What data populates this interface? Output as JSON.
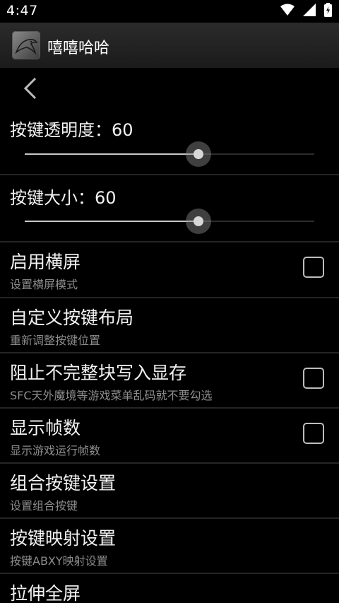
{
  "status_bar": {
    "time": "4:47",
    "icons": [
      "wifi-icon",
      "signal-icon",
      "battery-icon"
    ]
  },
  "action_bar": {
    "title": "嘻嘻哈哈",
    "icon": "app-logo-icon"
  },
  "sliders": [
    {
      "label": "按键透明度：60",
      "value": 60,
      "max": 100
    },
    {
      "label": "按键大小：60",
      "value": 60,
      "max": 100
    }
  ],
  "preferences": [
    {
      "title": "启用横屏",
      "summary": "设置横屏模式",
      "checkbox": true,
      "checked": false
    },
    {
      "title": "自定义按键布局",
      "summary": "重新调整按键位置",
      "checkbox": false
    },
    {
      "title": "阻止不完整块写入显存",
      "summary": "SFC天外魔境等游戏菜单乱码就不要勾选",
      "checkbox": true,
      "checked": false
    },
    {
      "title": "显示帧数",
      "summary": "显示游戏运行帧数",
      "checkbox": true,
      "checked": false
    },
    {
      "title": "组合按键设置",
      "summary": "设置组合按键",
      "checkbox": false
    },
    {
      "title": "按键映射设置",
      "summary": "按键ABXY映射设置",
      "checkbox": false
    },
    {
      "title": "拉伸全屏",
      "summary": "",
      "checkbox": false
    }
  ],
  "colors": {
    "background": "#000000",
    "action_bar": "#222222",
    "divider": "#252525",
    "summary_text": "#8c8c8c",
    "slider_active": "#c8c8c8"
  }
}
